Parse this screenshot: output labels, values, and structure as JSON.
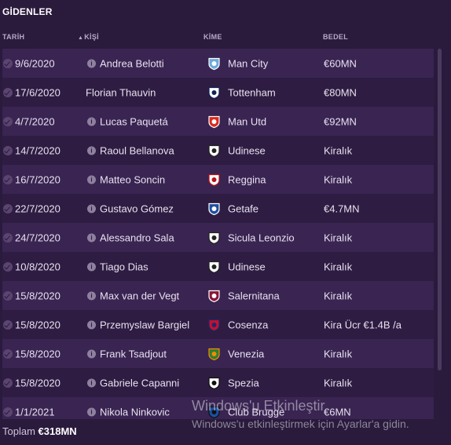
{
  "panel": {
    "title": "GİDENLER"
  },
  "columns": {
    "date": "TARİH",
    "player": "KİŞİ",
    "to": "KİME",
    "fee": "BEDEL"
  },
  "rows": [
    {
      "date": "9/6/2020",
      "player": "Andrea Belotti",
      "club": "Man City",
      "fee": "€60MN",
      "info": true,
      "badge": "man-city-crest-icon",
      "badge_colors": [
        "#6cabdd",
        "#ffffff"
      ]
    },
    {
      "date": "17/6/2020",
      "player": "Florian Thauvin",
      "club": "Tottenham",
      "fee": "€80MN",
      "info": false,
      "badge": "tottenham-crest-icon",
      "badge_colors": [
        "#ffffff",
        "#132257"
      ]
    },
    {
      "date": "4/7/2020",
      "player": "Lucas Paquetá",
      "club": "Man Utd",
      "fee": "€92MN",
      "info": true,
      "badge": "man-utd-crest-icon",
      "badge_colors": [
        "#da291c",
        "#ffffff"
      ]
    },
    {
      "date": "14/7/2020",
      "player": "Raoul Bellanova",
      "club": "Udinese",
      "fee": "Kiralık",
      "info": true,
      "badge": "udinese-crest-icon",
      "badge_colors": [
        "#ffffff",
        "#222222"
      ]
    },
    {
      "date": "16/7/2020",
      "player": "Matteo Soncin",
      "club": "Reggina",
      "fee": "Kiralık",
      "info": true,
      "badge": "reggina-crest-icon",
      "badge_colors": [
        "#ffffff",
        "#b5121b"
      ]
    },
    {
      "date": "22/7/2020",
      "player": "Gustavo Gómez",
      "club": "Getafe",
      "fee": "€4.7MN",
      "info": true,
      "badge": "getafe-crest-icon",
      "badge_colors": [
        "#1f4fa0",
        "#ffffff"
      ]
    },
    {
      "date": "24/7/2020",
      "player": "Alessandro Sala",
      "club": "Sicula Leonzio",
      "fee": "Kiralık",
      "info": true,
      "badge": "sicula-leonzio-crest-icon",
      "badge_colors": [
        "#ffffff",
        "#222222"
      ]
    },
    {
      "date": "10/8/2020",
      "player": "Tiago Dias",
      "club": "Udinese",
      "fee": "Kiralık",
      "info": true,
      "badge": "udinese-crest-icon",
      "badge_colors": [
        "#ffffff",
        "#222222"
      ]
    },
    {
      "date": "15/8/2020",
      "player": "Max van der Vegt",
      "club": "Salernitana",
      "fee": "Kiralık",
      "info": true,
      "badge": "salernitana-crest-icon",
      "badge_colors": [
        "#8a1538",
        "#ffffff"
      ]
    },
    {
      "date": "15/8/2020",
      "player": "Przemyslaw Bargiel",
      "club": "Cosenza",
      "fee": "Kira Ücr €1.4B /a",
      "info": true,
      "badge": "cosenza-crest-icon",
      "badge_colors": [
        "#c8102e",
        "#1a2a6c"
      ]
    },
    {
      "date": "15/8/2020",
      "player": "Frank Tsadjout",
      "club": "Venezia",
      "fee": "Kiralık",
      "info": true,
      "badge": "venezia-crest-icon",
      "badge_colors": [
        "#2f7d32",
        "#f28c00"
      ]
    },
    {
      "date": "15/8/2020",
      "player": "Gabriele Capanni",
      "club": "Spezia",
      "fee": "Kiralık",
      "info": true,
      "badge": "spezia-crest-icon",
      "badge_colors": [
        "#ffffff",
        "#111111"
      ]
    },
    {
      "date": "1/1/2021",
      "player": "Nikola Ninkovic",
      "club": "Club Brugge",
      "fee": "€6MN",
      "info": true,
      "badge": "club-brugge-crest-icon",
      "badge_colors": [
        "#1a4fa3",
        "#111111"
      ]
    }
  ],
  "footer": {
    "total_label": "Toplam",
    "total_value": "€318MN"
  },
  "watermark": {
    "title": "Windows'u Etkinleştir",
    "subtitle": "Windows'u etkinleştirmek için Ayarlar'a gidin."
  }
}
